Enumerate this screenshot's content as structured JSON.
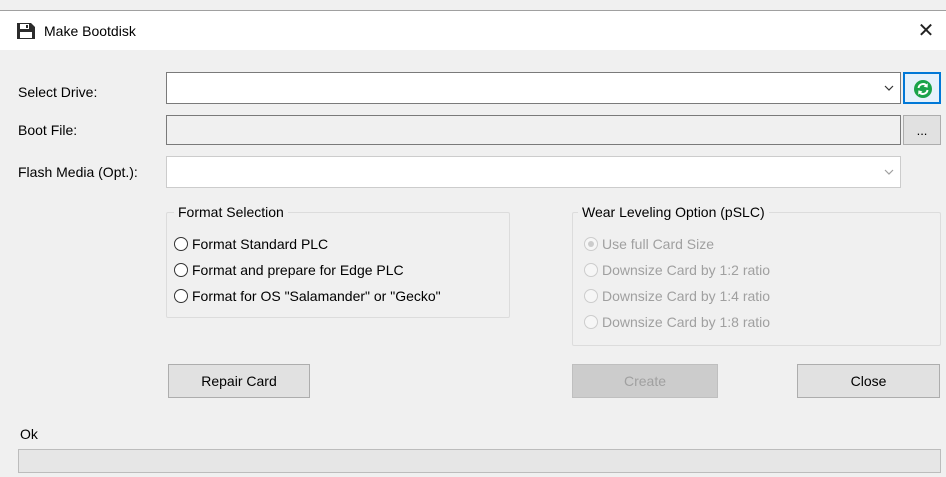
{
  "window": {
    "title": "Make Bootdisk",
    "close_glyph": "✕"
  },
  "fields": {
    "select_drive": {
      "label": "Select Drive:",
      "value": ""
    },
    "boot_file": {
      "label": "Boot File:",
      "value": "",
      "browse_label": "..."
    },
    "flash_media": {
      "label": "Flash Media (Opt.):",
      "value": ""
    }
  },
  "format_selection": {
    "title": "Format Selection",
    "options": [
      "Format Standard PLC",
      "Format and prepare for Edge PLC",
      "Format for OS \"Salamander\" or \"Gecko\""
    ]
  },
  "wear_leveling": {
    "title": "Wear Leveling Option (pSLC)",
    "options": [
      "Use full Card Size",
      "Downsize Card by 1:2 ratio",
      "Downsize Card by 1:4 ratio",
      "Downsize Card by 1:8 ratio"
    ],
    "selected_index": 0
  },
  "buttons": {
    "repair": "Repair Card",
    "create": "Create",
    "close": "Close"
  },
  "status": {
    "text": "Ok",
    "progress": 0
  },
  "icons": {
    "title": "floppy-disk-icon",
    "refresh": "refresh-icon",
    "refresh_color": "#1aa34a"
  }
}
